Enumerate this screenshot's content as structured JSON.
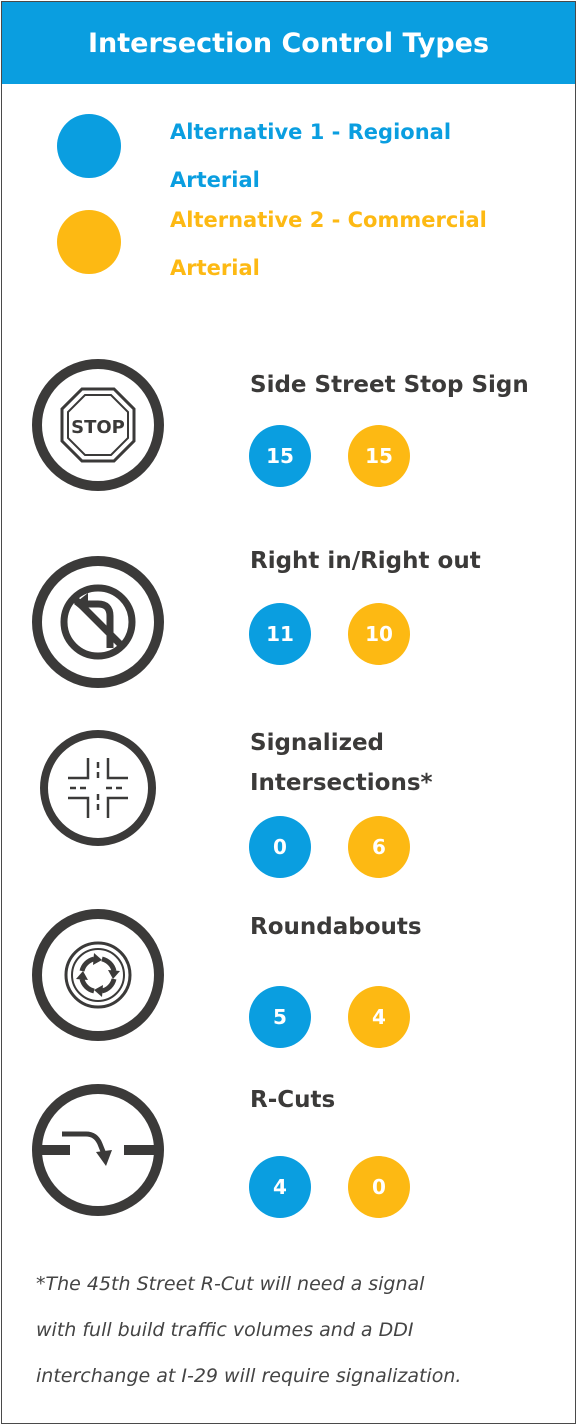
{
  "header": {
    "title": "Intersection Control Types"
  },
  "colors": {
    "header_bg": "#0a9ee0",
    "alt1": "#0a9ee0",
    "alt2": "#fdb913",
    "icon": "#3b3a39"
  },
  "legend": {
    "items": [
      {
        "line1": "Alternative 1 - Regional",
        "line2": "Arterial"
      },
      {
        "line1": "Alternative 2 - Commercial",
        "line2": "Arterial"
      }
    ]
  },
  "types": [
    {
      "label": "Side Street Stop Sign",
      "icon": "stop-sign-icon",
      "alt1": "15",
      "alt2": "15",
      "stop_text": "STOP"
    },
    {
      "label": "Right in/Right out",
      "icon": "no-left-turn-icon",
      "alt1": "11",
      "alt2": "10"
    },
    {
      "label_line1": "Signalized",
      "label_line2": "Intersections*",
      "icon": "intersection-icon",
      "alt1": "0",
      "alt2": "6"
    },
    {
      "label": "Roundabouts",
      "icon": "roundabout-icon",
      "alt1": "5",
      "alt2": "4"
    },
    {
      "label": "R-Cuts",
      "icon": "r-cut-icon",
      "alt1": "4",
      "alt2": "0"
    }
  ],
  "footnote": {
    "line1": "*The 45th Street R-Cut will need a signal",
    "line2": "with full build traffic volumes and a DDI",
    "line3": "interchange at I-29 will require signalization."
  }
}
